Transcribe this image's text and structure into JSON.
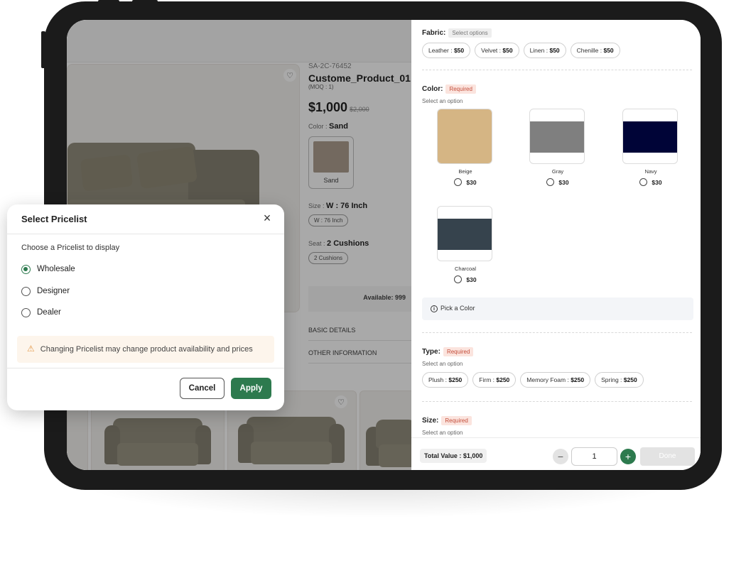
{
  "product": {
    "sku": "SA-2C-76452",
    "name": "Custome_Product_01",
    "moq": "(MOQ : 1)",
    "price": "$1,000",
    "price_old": "$2,000",
    "color_label": "Color : ",
    "color_value": "Sand",
    "color_swatch_label": "Sand",
    "size_label": "Size : ",
    "size_value": "W : 76 Inch",
    "size_pill": "W : 76 Inch",
    "seat_label": "Seat : ",
    "seat_value": "2 Cushions",
    "seat_pill": "2 Cushions",
    "available": "Available: 999",
    "accordion": [
      "BASIC DETAILS",
      "OTHER INFORMATION"
    ]
  },
  "config": {
    "fabric": {
      "label": "Fabric:",
      "tag": "Select options",
      "options": [
        {
          "name": "Leather",
          "price": "$50"
        },
        {
          "name": "Velvet",
          "price": "$50"
        },
        {
          "name": "Linen",
          "price": "$50"
        },
        {
          "name": "Chenille",
          "price": "$50"
        }
      ]
    },
    "color": {
      "label": "Color:",
      "tag": "Required",
      "sub": "Select an option",
      "options": [
        {
          "name": "Beige",
          "price": "$30",
          "hex": "#d5b584"
        },
        {
          "name": "Gray",
          "price": "$30",
          "hex": "#7f7f7f"
        },
        {
          "name": "Navy",
          "price": "$30",
          "hex": "#000437"
        },
        {
          "name": "Charcoal",
          "price": "$30",
          "hex": "#36434d"
        }
      ],
      "hint": "Pick a Color"
    },
    "type": {
      "label": "Type:",
      "tag": "Required",
      "sub": "Select an option",
      "options": [
        {
          "name": "Plush",
          "price": "$250"
        },
        {
          "name": "Firm",
          "price": "$250"
        },
        {
          "name": "Memory Foam",
          "price": "$250"
        },
        {
          "name": "Spring",
          "price": "$250"
        }
      ]
    },
    "size": {
      "label": "Size:",
      "tag": "Required",
      "sub": "Select an option"
    }
  },
  "footer": {
    "total": "Total Value : $1,000",
    "qty": "1",
    "minus": "−",
    "plus": "+",
    "done": "Done"
  },
  "modal": {
    "title": "Select Pricelist",
    "close": "×",
    "prompt": "Choose a Pricelist to display",
    "options": [
      "Wholesale",
      "Designer",
      "Dealer"
    ],
    "selected": "Wholesale",
    "warning": "Changing Pricelist may change product availability and prices",
    "cancel": "Cancel",
    "apply": "Apply"
  },
  "colors": {
    "accent": "#2d7a4e",
    "required_tag": "#c44e3b",
    "warning": "#e39a4c"
  }
}
